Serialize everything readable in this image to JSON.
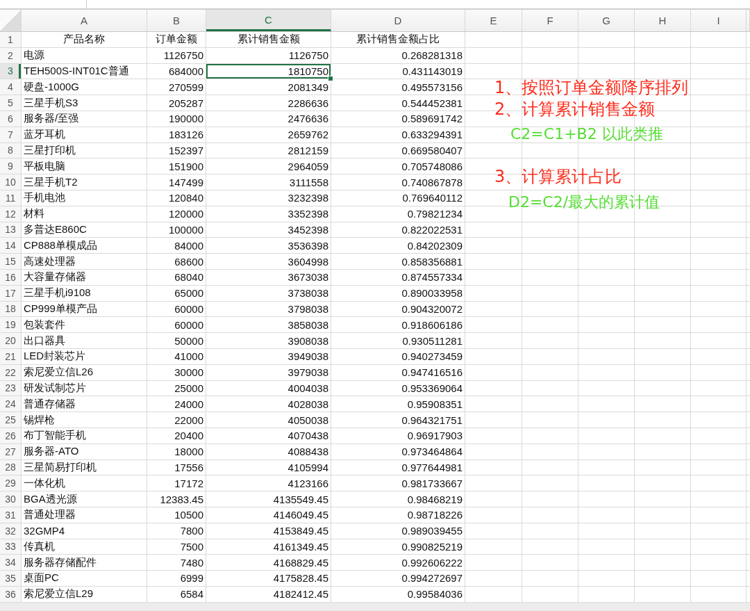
{
  "columns": [
    {
      "label": "A",
      "selected": false
    },
    {
      "label": "B",
      "selected": false
    },
    {
      "label": "C",
      "selected": true
    },
    {
      "label": "D",
      "selected": false
    },
    {
      "label": "E",
      "selected": false
    },
    {
      "label": "F",
      "selected": false
    },
    {
      "label": "G",
      "selected": false
    },
    {
      "label": "H",
      "selected": false
    },
    {
      "label": "I",
      "selected": false
    }
  ],
  "rows": [
    {
      "num": "1",
      "kind": "header",
      "selected": false,
      "cells": [
        "产品名称",
        "订单金额",
        "累计销售金额",
        "累计销售金额占比"
      ]
    },
    {
      "num": "2",
      "kind": "data",
      "selected": false,
      "cells": [
        "电源",
        "1126750",
        "1126750",
        "0.268281318"
      ]
    },
    {
      "num": "3",
      "kind": "data",
      "selected": true,
      "cells": [
        "TEH500S-INT01C普通",
        "684000",
        "1810750",
        "0.431143019"
      ]
    },
    {
      "num": "4",
      "kind": "data",
      "selected": false,
      "cells": [
        "硬盘-1000G",
        "270599",
        "2081349",
        "0.495573156"
      ]
    },
    {
      "num": "5",
      "kind": "data",
      "selected": false,
      "cells": [
        "三星手机S3",
        "205287",
        "2286636",
        "0.544452381"
      ]
    },
    {
      "num": "6",
      "kind": "data",
      "selected": false,
      "cells": [
        "服务器/至强",
        "190000",
        "2476636",
        "0.589691742"
      ]
    },
    {
      "num": "7",
      "kind": "data",
      "selected": false,
      "cells": [
        "蓝牙耳机",
        "183126",
        "2659762",
        "0.633294391"
      ]
    },
    {
      "num": "8",
      "kind": "data",
      "selected": false,
      "cells": [
        "三星打印机",
        "152397",
        "2812159",
        "0.669580407"
      ]
    },
    {
      "num": "9",
      "kind": "data",
      "selected": false,
      "cells": [
        "平板电脑",
        "151900",
        "2964059",
        "0.705748086"
      ]
    },
    {
      "num": "10",
      "kind": "data",
      "selected": false,
      "cells": [
        "三星手机T2",
        "147499",
        "3111558",
        "0.740867878"
      ]
    },
    {
      "num": "11",
      "kind": "data",
      "selected": false,
      "cells": [
        "手机电池",
        "120840",
        "3232398",
        "0.769640112"
      ]
    },
    {
      "num": "12",
      "kind": "data",
      "selected": false,
      "cells": [
        "材料",
        "120000",
        "3352398",
        "0.79821234"
      ]
    },
    {
      "num": "13",
      "kind": "data",
      "selected": false,
      "cells": [
        "多普达E860C",
        "100000",
        "3452398",
        "0.822022531"
      ]
    },
    {
      "num": "14",
      "kind": "data",
      "selected": false,
      "cells": [
        "CP888单模成品",
        "84000",
        "3536398",
        "0.84202309"
      ]
    },
    {
      "num": "15",
      "kind": "data",
      "selected": false,
      "cells": [
        "高速处理器",
        "68600",
        "3604998",
        "0.858356881"
      ]
    },
    {
      "num": "16",
      "kind": "data",
      "selected": false,
      "cells": [
        "大容量存储器",
        "68040",
        "3673038",
        "0.874557334"
      ]
    },
    {
      "num": "17",
      "kind": "data",
      "selected": false,
      "cells": [
        "三星手机i9108",
        "65000",
        "3738038",
        "0.890033958"
      ]
    },
    {
      "num": "18",
      "kind": "data",
      "selected": false,
      "cells": [
        "CP999单模产品",
        "60000",
        "3798038",
        "0.904320072"
      ]
    },
    {
      "num": "19",
      "kind": "data",
      "selected": false,
      "cells": [
        "包装套件",
        "60000",
        "3858038",
        "0.918606186"
      ]
    },
    {
      "num": "20",
      "kind": "data",
      "selected": false,
      "cells": [
        "出口器具",
        "50000",
        "3908038",
        "0.930511281"
      ]
    },
    {
      "num": "21",
      "kind": "data",
      "selected": false,
      "cells": [
        "LED封装芯片",
        "41000",
        "3949038",
        "0.940273459"
      ]
    },
    {
      "num": "22",
      "kind": "data",
      "selected": false,
      "cells": [
        "索尼爱立信L26",
        "30000",
        "3979038",
        "0.947416516"
      ]
    },
    {
      "num": "23",
      "kind": "data",
      "selected": false,
      "cells": [
        "研发试制芯片",
        "25000",
        "4004038",
        "0.953369064"
      ]
    },
    {
      "num": "24",
      "kind": "data",
      "selected": false,
      "cells": [
        "普通存储器",
        "24000",
        "4028038",
        "0.95908351"
      ]
    },
    {
      "num": "25",
      "kind": "data",
      "selected": false,
      "cells": [
        "锡焊枪",
        "22000",
        "4050038",
        "0.964321751"
      ]
    },
    {
      "num": "26",
      "kind": "data",
      "selected": false,
      "cells": [
        "布丁智能手机",
        "20400",
        "4070438",
        "0.96917903"
      ]
    },
    {
      "num": "27",
      "kind": "data",
      "selected": false,
      "cells": [
        "服务器-ATO",
        "18000",
        "4088438",
        "0.973464864"
      ]
    },
    {
      "num": "28",
      "kind": "data",
      "selected": false,
      "cells": [
        "三星简易打印机",
        "17556",
        "4105994",
        "0.977644981"
      ]
    },
    {
      "num": "29",
      "kind": "data",
      "selected": false,
      "cells": [
        "一体化机",
        "17172",
        "4123166",
        "0.981733667"
      ]
    },
    {
      "num": "30",
      "kind": "data",
      "selected": false,
      "cells": [
        "BGA透光源",
        "12383.45",
        "4135549.45",
        "0.98468219"
      ]
    },
    {
      "num": "31",
      "kind": "data",
      "selected": false,
      "cells": [
        "普通处理器",
        "10500",
        "4146049.45",
        "0.98718226"
      ]
    },
    {
      "num": "32",
      "kind": "data",
      "selected": false,
      "cells": [
        "32GMP4",
        "7800",
        "4153849.45",
        "0.989039455"
      ]
    },
    {
      "num": "33",
      "kind": "data",
      "selected": false,
      "cells": [
        "传真机",
        "7500",
        "4161349.45",
        "0.990825219"
      ]
    },
    {
      "num": "34",
      "kind": "data",
      "selected": false,
      "cells": [
        "服务器存储配件",
        "7480",
        "4168829.45",
        "0.992606222"
      ]
    },
    {
      "num": "35",
      "kind": "data",
      "selected": false,
      "cells": [
        "桌面PC",
        "6999",
        "4175828.45",
        "0.994272697"
      ]
    },
    {
      "num": "36",
      "kind": "data",
      "selected": false,
      "cells": [
        "索尼爱立信L29",
        "6584",
        "4182412.45",
        "0.99584036"
      ]
    }
  ],
  "annotations": [
    {
      "text": "1、按照订单金额降序排列",
      "color": "#ff2a1a"
    },
    {
      "text": "2、计算累计销售金额",
      "color": "#ff2a1a"
    },
    {
      "text": "C2=C1+B2 以此类推",
      "color": "#55dd33"
    },
    {
      "text": "3、计算累计占比",
      "color": "#ff2a1a"
    },
    {
      "text": "D2=C2/最大的累计值",
      "color": "#55dd33"
    }
  ]
}
